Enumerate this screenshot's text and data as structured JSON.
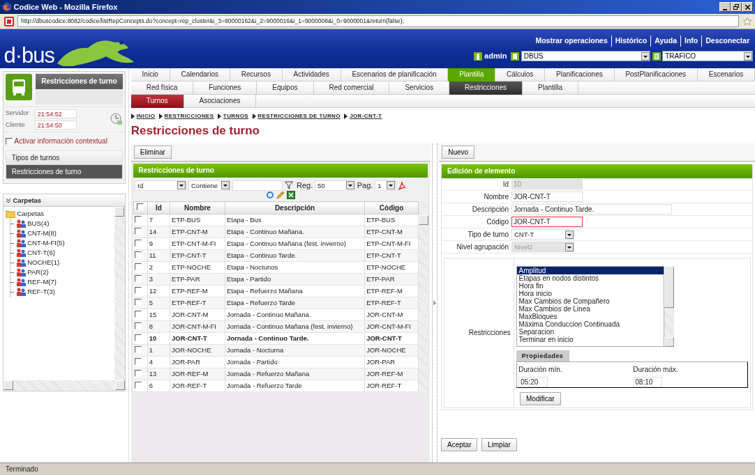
{
  "window": {
    "title": "Codice Web - Mozilla Firefox"
  },
  "address_bar": {
    "url": "http://dbuscodice:8082/codice/listRepConcepts.do?concept=rep_cluster&i_3=90000162&i_2=9000016&i_1=9000008&i_0=9000001&return(false);"
  },
  "header": {
    "logo": "d·bus",
    "links": [
      "Mostrar operaciones",
      "Histórico",
      "Ayuda",
      "Info",
      "Desconectar"
    ],
    "user": "admin",
    "selects": [
      "DBUS",
      "TRAFICO"
    ]
  },
  "sidebar": {
    "module_title": "Restricciones de turno",
    "clock": [
      {
        "label": "Servidor",
        "value": "21:54:52"
      },
      {
        "label": "Cliente",
        "value": "21:54:50"
      }
    ],
    "context_option": {
      "label": "Activar información contextual",
      "checked": false
    },
    "menu": [
      {
        "label": "Tipos de turnos",
        "selected": false
      },
      {
        "label": "Restricciones de turno",
        "selected": true
      }
    ]
  },
  "folders": {
    "title": "Carpetas",
    "tree": [
      {
        "label": "Carpetas",
        "kind": "folder",
        "children": [
          {
            "label": "BUS(4)",
            "kind": "group"
          },
          {
            "label": "CNT-M(8)",
            "kind": "group"
          },
          {
            "label": "CNT-M-FI(5)",
            "kind": "group"
          },
          {
            "label": "CNT-T(6)",
            "kind": "group"
          },
          {
            "label": "NOCHE(1)",
            "kind": "group"
          },
          {
            "label": "PAR(2)",
            "kind": "group"
          },
          {
            "label": "REF-M(7)",
            "kind": "group"
          },
          {
            "label": "REF-T(3)",
            "kind": "group"
          }
        ]
      }
    ]
  },
  "main_tabs": [
    {
      "label": "Inicio",
      "selected": false
    },
    {
      "label": "Calendarios",
      "selected": false
    },
    {
      "label": "Recursos",
      "selected": false
    },
    {
      "label": "Actividades",
      "selected": false
    },
    {
      "label": "Escenarios de planificación",
      "selected": false
    },
    {
      "label": "Plantilla",
      "selected": true
    },
    {
      "label": "Cálculos",
      "selected": false
    },
    {
      "label": "Planificaciones",
      "selected": false
    },
    {
      "label": "PostPlanificaciones",
      "selected": false
    },
    {
      "label": "Escenarios",
      "selected": false
    }
  ],
  "sub_tabs": [
    {
      "label": "Red física",
      "selected": false
    },
    {
      "label": "Funciones",
      "selected": false
    },
    {
      "label": "Equipos",
      "selected": false
    },
    {
      "label": "Red comercial",
      "selected": false
    },
    {
      "label": "Servicios",
      "selected": false
    },
    {
      "label": "Restricciones",
      "selected": true
    },
    {
      "label": "Plantilla",
      "selected": false
    }
  ],
  "section_tabs": [
    {
      "label": "Turnos",
      "selected": true
    },
    {
      "label": "Asociaciones",
      "selected": false
    }
  ],
  "breadcrumb": [
    "INICIO",
    "RESTRICCIONES",
    "TURNOS",
    "RESTRICCIONES DE TURNO",
    "JOR-CNT-T"
  ],
  "page_title": "Restricciones de turno",
  "list": {
    "action": "Eliminar",
    "title": "Restricciones de turno",
    "filter": {
      "field": "Id",
      "operator": "Contiene",
      "records_label": "Reg.",
      "records": "50",
      "page_label": "Pag.",
      "page": "1"
    },
    "header_checked": false,
    "columns": [
      "Id",
      "Nombre",
      "Descripción",
      "Código"
    ],
    "rows": [
      {
        "cells": [
          "7",
          "ETP-BUS",
          "Etapa - Bus",
          "ETP-BUS"
        ],
        "checked": false,
        "selected": false
      },
      {
        "cells": [
          "14",
          "ETP-CNT-M",
          "Etapa - Continuo Mañana.",
          "ETP-CNT-M"
        ],
        "checked": false,
        "selected": false
      },
      {
        "cells": [
          "9",
          "ETP-CNT-M-FI",
          "Etapa - Continuo Mañana (fest. invierno)",
          "ETP-CNT-M-FI"
        ],
        "checked": false,
        "selected": false
      },
      {
        "cells": [
          "11",
          "ETP-CNT-T",
          "Etapa - Continuo Tarde.",
          "ETP-CNT-T"
        ],
        "checked": false,
        "selected": false
      },
      {
        "cells": [
          "2",
          "ETP-NOCHE",
          "Etapa - Noctunos",
          "ETP-NOCHE"
        ],
        "checked": false,
        "selected": false
      },
      {
        "cells": [
          "3",
          "ETP-PAR",
          "Etapa - Partido",
          "ETP-PAR"
        ],
        "checked": false,
        "selected": false
      },
      {
        "cells": [
          "12",
          "ETP-REF-M",
          "Etapa - Refuerzo Mañana",
          "ETP-REF-M"
        ],
        "checked": false,
        "selected": false
      },
      {
        "cells": [
          "5",
          "ETP-REF-T",
          "Etapa - Refuerzo Tarde",
          "ETP-REF-T"
        ],
        "checked": false,
        "selected": false
      },
      {
        "cells": [
          "15",
          "JOR-CNT-M",
          "Jornada - Continuo Mañana.",
          "JOR-CNT-M"
        ],
        "checked": false,
        "selected": false
      },
      {
        "cells": [
          "8",
          "JOR-CNT-M-FI",
          "Jornada - Continuo Mañana (fest. invierno)",
          "JOR-CNT-M-FI"
        ],
        "checked": false,
        "selected": false
      },
      {
        "cells": [
          "10",
          "JOR-CNT-T",
          "Jornada - Continuo Tarde.",
          "JOR-CNT-T"
        ],
        "checked": false,
        "selected": true
      },
      {
        "cells": [
          "1",
          "JOR-NOCHE",
          "Jornada - Nocturna",
          "JOR-NOCHE"
        ],
        "checked": false,
        "selected": false
      },
      {
        "cells": [
          "4",
          "JOR-PAR",
          "Jornada - Partido",
          "JOR-PAR"
        ],
        "checked": false,
        "selected": false
      },
      {
        "cells": [
          "13",
          "JOR-REF-M",
          "Jornada - Refuerzo Mañana",
          "JOR-REF-M"
        ],
        "checked": false,
        "selected": false
      },
      {
        "cells": [
          "6",
          "JOR-REF-T",
          "Jornada - Refuerzo Tarde",
          "JOR-REF-T"
        ],
        "checked": false,
        "selected": false
      }
    ]
  },
  "editor": {
    "action": "Nuevo",
    "title": "Edición de elemento",
    "fields": [
      {
        "label": "Id",
        "value": "10",
        "kind": "text",
        "disabled": true,
        "highlighted": false
      },
      {
        "label": "Nombre",
        "value": "JOR-CNT-T",
        "kind": "text",
        "disabled": false,
        "highlighted": false
      },
      {
        "label": "Descripción",
        "value": "Jornada - Continuo Tarde.",
        "kind": "wide",
        "disabled": false,
        "highlighted": false
      },
      {
        "label": "Código",
        "value": "JOR-CNT-T",
        "kind": "text",
        "disabled": false,
        "highlighted": true
      },
      {
        "label": "Tipo de turno",
        "value": "CNT-T",
        "kind": "select",
        "disabled": false,
        "highlighted": false
      },
      {
        "label": "Nivel agrupación",
        "value": "Nivel2",
        "kind": "select",
        "disabled": true,
        "highlighted": false
      }
    ],
    "restrictions": {
      "label": "Restricciones",
      "options": [
        {
          "label": "Amplitud",
          "selected": true
        },
        {
          "label": "Etapas en nodos distintos",
          "selected": false
        },
        {
          "label": "Hora fin",
          "selected": false
        },
        {
          "label": "Hora inicio",
          "selected": false
        },
        {
          "label": "Max Cambios de Compañero",
          "selected": false
        },
        {
          "label": "Max Cambios de Linea",
          "selected": false
        },
        {
          "label": "MaxBloques",
          "selected": false
        },
        {
          "label": "Máxima Conduccion Continuada",
          "selected": false
        },
        {
          "label": "Separacion",
          "selected": false
        },
        {
          "label": "Terminar en inicio",
          "selected": false
        }
      ],
      "properties_tab": "Propiedades",
      "properties": [
        {
          "label": "Duración mín.",
          "value": "05:20"
        },
        {
          "label": "Duración máx.",
          "value": "08:10"
        }
      ],
      "apply": "Modificar"
    },
    "buttons": [
      "Aceptar",
      "Limpiar"
    ]
  },
  "status_bar": "Terminado"
}
